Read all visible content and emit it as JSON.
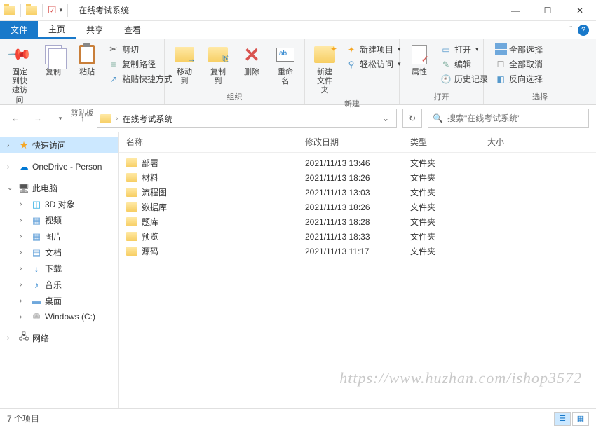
{
  "window": {
    "title": "在线考试系统"
  },
  "tabs": {
    "file": "文件",
    "home": "主页",
    "share": "共享",
    "view": "查看"
  },
  "ribbon": {
    "pin": "固定到快\n速访问",
    "copy": "复制",
    "paste": "粘贴",
    "cut": "剪切",
    "copy_path": "复制路径",
    "paste_shortcut": "粘贴快捷方式",
    "clipboard_group": "剪贴板",
    "move_to": "移动到",
    "copy_to": "复制到",
    "delete": "删除",
    "rename": "重命名",
    "organize_group": "组织",
    "new_folder": "新建\n文件夹",
    "new_item": "新建项目",
    "easy_access": "轻松访问",
    "new_group": "新建",
    "properties": "属性",
    "open": "打开",
    "edit": "编辑",
    "history": "历史记录",
    "open_group": "打开",
    "select_all": "全部选择",
    "select_none": "全部取消",
    "invert_sel": "反向选择",
    "select_group": "选择"
  },
  "address": {
    "path": "在线考试系统"
  },
  "search": {
    "placeholder": "搜索\"在线考试系统\""
  },
  "columns": {
    "name": "名称",
    "date": "修改日期",
    "type": "类型",
    "size": "大小"
  },
  "files": [
    {
      "name": "部署",
      "date": "2021/11/13 13:46",
      "type": "文件夹"
    },
    {
      "name": "材料",
      "date": "2021/11/13 18:26",
      "type": "文件夹"
    },
    {
      "name": "流程图",
      "date": "2021/11/13 13:03",
      "type": "文件夹"
    },
    {
      "name": "数据库",
      "date": "2021/11/13 18:26",
      "type": "文件夹"
    },
    {
      "name": "题库",
      "date": "2021/11/13 18:28",
      "type": "文件夹"
    },
    {
      "name": "预览",
      "date": "2021/11/13 18:33",
      "type": "文件夹"
    },
    {
      "name": "源码",
      "date": "2021/11/13 11:17",
      "type": "文件夹"
    }
  ],
  "sidebar": {
    "quick_access": "快速访问",
    "onedrive": "OneDrive - Person",
    "this_pc": "此电脑",
    "objects_3d": "3D 对象",
    "videos": "视频",
    "pictures": "图片",
    "documents": "文档",
    "downloads": "下载",
    "music": "音乐",
    "desktop": "桌面",
    "c_drive": "Windows (C:)",
    "network": "网络"
  },
  "status": {
    "count": "7 个项目"
  },
  "watermark": "https://www.huzhan.com/ishop3572"
}
